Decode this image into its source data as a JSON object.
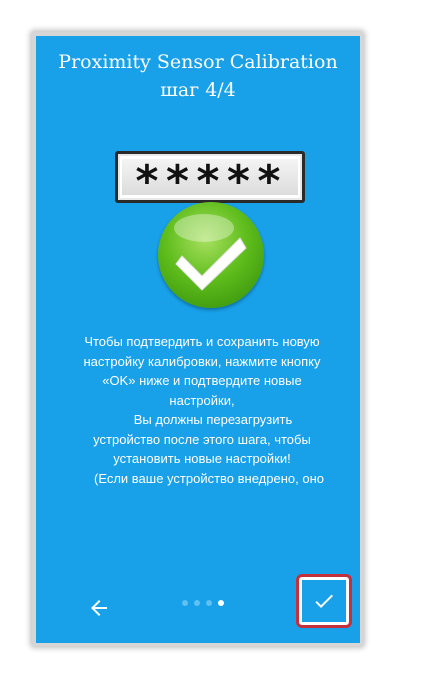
{
  "header": {
    "title": "Proximity Sensor Calibration",
    "step": "шаг 4/4"
  },
  "illustration": {
    "password_mask": "*****",
    "icon": "green-checkmark-icon"
  },
  "body": {
    "lines": [
      "Чтобы подтвердить и сохранить новую",
      "настройку калибровки, нажмите кнопку",
      "«OK» ниже и подтвердите новые",
      "настройки,",
      "Вы должны перезагрузить",
      "устройство после этого шага, чтобы",
      "установить новые настройки!",
      "(Если ваше устройство внедрено, оно"
    ]
  },
  "footer": {
    "back_icon": "arrow-left-icon",
    "confirm_icon": "check-icon",
    "pager": {
      "total": 4,
      "current": 4
    }
  },
  "colors": {
    "background": "#18a0e8",
    "highlight": "#c4313c",
    "check_green": "#5fbd1c"
  }
}
